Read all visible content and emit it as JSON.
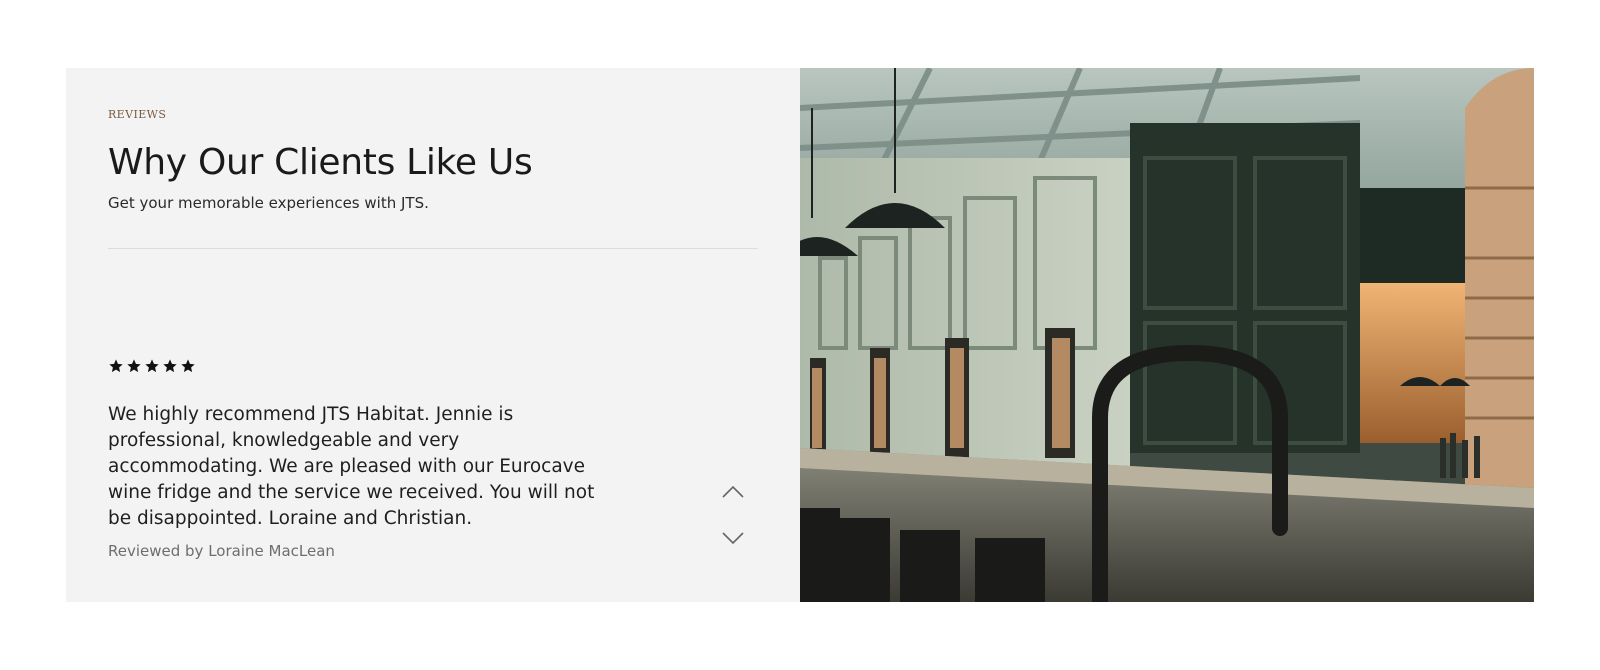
{
  "reviews_section": {
    "eyebrow": "REVIEWS",
    "title": "Why Our Clients Like Us",
    "subtitle": "Get your memorable experiences with JTS.",
    "rating": 5,
    "review_text": "We highly recommend JTS Habitat. Jennie is professional, knowledgeable and very accommodating. We are pleased with our Eurocave wine fridge and the service we received. You will not be disappointed. Loraine and Christian.",
    "reviewer": "Reviewed by Loraine MacLean",
    "icons": {
      "star": "star-icon",
      "prev": "chevron-up-icon",
      "next": "chevron-down-icon"
    }
  },
  "photo": {
    "subject": "restaurant-bar-interior-photo"
  },
  "colors": {
    "panel_background": "#f3f3f3",
    "eyebrow": "#7a5c3e",
    "text": "#1f1f1f",
    "muted_text": "#6e6e6e"
  }
}
